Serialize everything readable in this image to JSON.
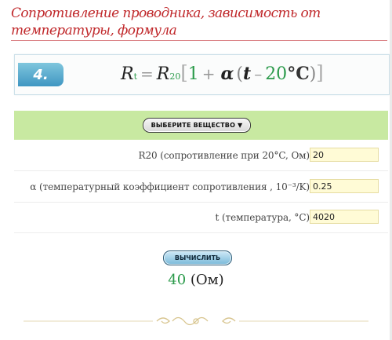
{
  "page": {
    "title": "Сопротивление проводника, зависимость от температуры, формула"
  },
  "formula": {
    "number": "4.",
    "R": "R",
    "sub_t": "t",
    "equals": "=",
    "sub_20": "20",
    "open_bracket": "[",
    "one": "1",
    "plus": "+",
    "alpha": "α",
    "open_paren": "(",
    "t": "t",
    "minus": "–",
    "twenty": "20",
    "deg_c": "°C",
    "close_paren": ")",
    "close_bracket": "]"
  },
  "substance_button": "ВЫБЕРИТЕ ВЕЩЕСТВО ▼",
  "fields": [
    {
      "label": "R20 (сопротивление при 20°C, Ом)",
      "value": "20"
    },
    {
      "label": "α (температурный коэффициент сопротивления , 10⁻³/K)",
      "value": "0.25"
    },
    {
      "label": "t (температура, °C)",
      "value": "4020"
    }
  ],
  "calculate_button": "ВЫЧИСЛИТЬ",
  "result": {
    "value": "40",
    "unit": "(Ом)"
  },
  "colors": {
    "title": "#c0282b",
    "result": "#2a9a4a",
    "band": "#c8e9a1",
    "input_bg": "#fffbd6"
  }
}
